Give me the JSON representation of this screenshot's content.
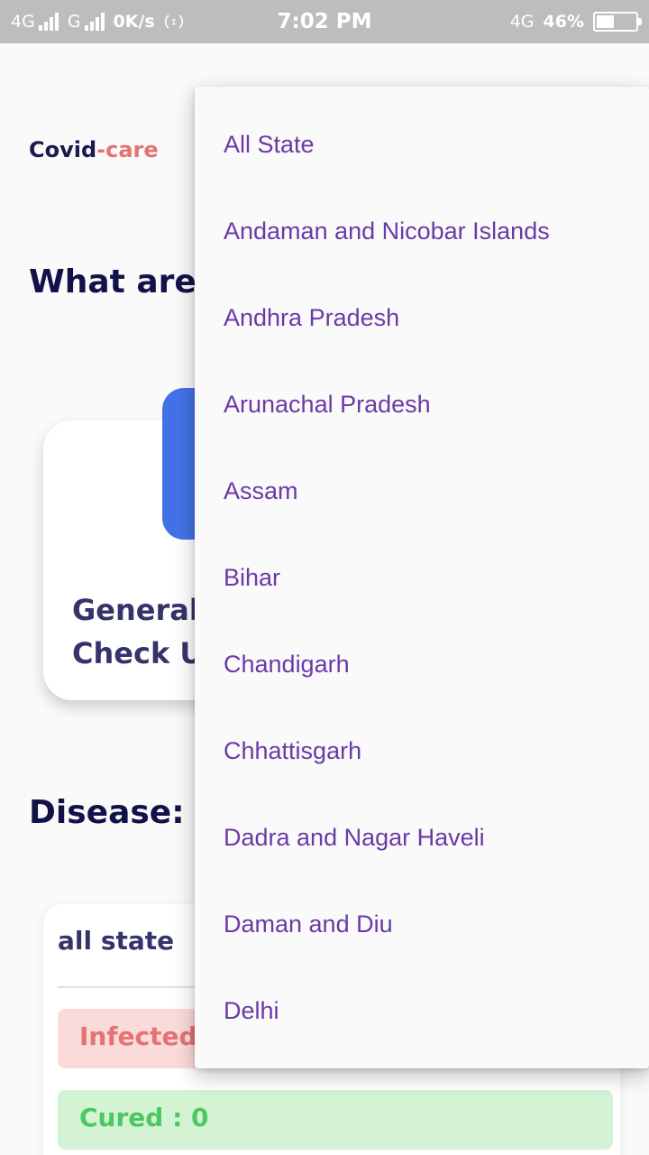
{
  "status_bar": {
    "network_1": "4G",
    "network_2": "G",
    "speed": "0K/s",
    "time": "7:02 PM",
    "network_right": "4G",
    "battery_percent": "46%",
    "battery_level": 0.46
  },
  "app": {
    "brand_prefix": "Covid",
    "brand_suffix": "-care",
    "question_title": "What are y",
    "checkup_title": "General\nCheck Up",
    "disease_title": "Disease: C",
    "stats": {
      "state_label": "all state",
      "infected_text": "Infected :",
      "cured_text": "Cured : 0"
    }
  },
  "dropdown": {
    "items": [
      "All State",
      "Andaman and Nicobar Islands",
      "Andhra Pradesh",
      "Arunachal Pradesh",
      "Assam",
      "Bihar",
      "Chandigarh",
      "Chhattisgarh",
      "Dadra and Nagar Haveli",
      "Daman and Diu",
      "Delhi"
    ]
  },
  "colors": {
    "brand_dark": "#1a1a4e",
    "brand_accent": "#e57373",
    "tile_blue": "#4372e6",
    "menu_text": "#6a3aa6",
    "cured_green": "#4cc862"
  }
}
